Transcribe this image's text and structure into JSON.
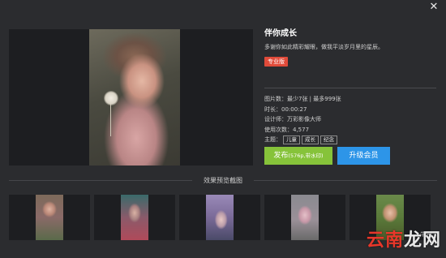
{
  "window": {
    "close_icon": "close-icon"
  },
  "product": {
    "title": "伴你成长",
    "description": "多谢你如此精彩耀眼，做我平淡岁月里的星辰。",
    "badge": "专业版"
  },
  "meta": {
    "images": "图片数：最少7张 | 最多999张",
    "duration": "时长：00:00:27",
    "designer": "设计师：万彩影像大师",
    "uses": "使用次数：4,577",
    "topic_label": "主题：",
    "tags": [
      "儿童",
      "成长",
      "纪念"
    ]
  },
  "actions": {
    "publish_label": "发布",
    "publish_sub": "(576p,带水印)",
    "upgrade_label": "升级会员"
  },
  "preview_section": {
    "title": "效果预览截图"
  },
  "watermark": {
    "part1": "云南",
    "part2": "龙网",
    "small": "牛园"
  },
  "colors": {
    "publish": "#86c33a",
    "upgrade": "#2d95e8",
    "badge": "#e04b3a",
    "background": "#2b2c2f"
  }
}
